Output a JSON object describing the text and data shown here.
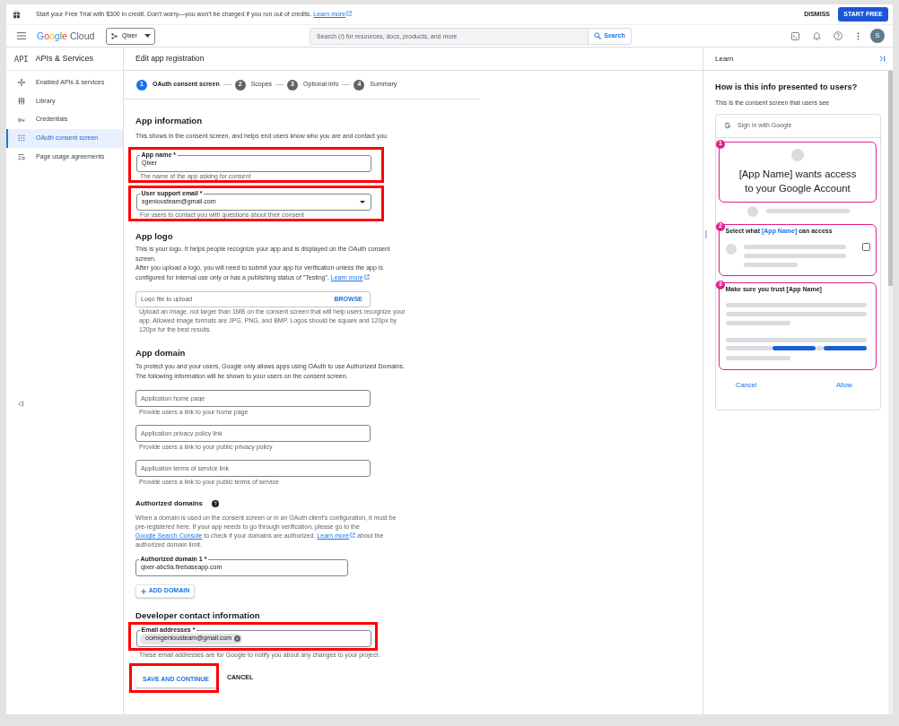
{
  "banner": {
    "message": [
      {
        "kind": "text",
        "text": "Start your Free Trial with $300 in credit. Don't worry—you won't be charged if you run out of credits."
      },
      {
        "kind": "link",
        "text": "Learn more",
        "external": true
      }
    ],
    "dismiss": "DISMISS",
    "action": "START FREE"
  },
  "header": {
    "logo": {
      "brand": "Google",
      "product": "Cloud"
    },
    "project": "Qixer",
    "search": {
      "placeholder": "Search (/) for resources, docs, products, and more",
      "button": "Search"
    },
    "avatar": "S"
  },
  "sidebar": {
    "badge": "API",
    "title": "APIs & Services",
    "items": [
      {
        "label": "Enabled APIs & services",
        "selected": false
      },
      {
        "label": "Library",
        "selected": false
      },
      {
        "label": "Credentials",
        "selected": false
      },
      {
        "label": "OAuth consent screen",
        "selected": true
      },
      {
        "label": "Page usage agreements",
        "selected": false
      }
    ]
  },
  "page": {
    "title": "Edit app registration",
    "steps": [
      {
        "number": "1",
        "label": "OAuth consent screen",
        "selected": true
      },
      {
        "number": "2",
        "label": "Scopes",
        "selected": false
      },
      {
        "number": "3",
        "label": "Optional info",
        "selected": false
      },
      {
        "number": "4",
        "label": "Summary",
        "selected": false
      }
    ]
  },
  "app_information": {
    "heading": "App information",
    "description": "This shows in the consent screen, and helps end users know who you are and contact you",
    "fields": [
      {
        "kind": "text",
        "label": "App name *",
        "value": "Qixer",
        "helper": "The name of the app asking for consent",
        "highlighted": true
      },
      {
        "kind": "select",
        "label": "User support email *",
        "value": "sgeniousteam@gmail.com",
        "helper": "For users to contact you with questions about their consent",
        "highlighted": true
      }
    ]
  },
  "app_logo": {
    "heading": "App logo",
    "paragraphs": [
      [
        {
          "kind": "text",
          "text": "This is your logo. It helps people recognize your app and is displayed on the OAuth consent screen."
        }
      ],
      [
        {
          "kind": "text",
          "text": "After you upload a logo, you will need to submit your app for verification unless the app is configured for internal use only or has a publishing status of \"Testing\"."
        },
        {
          "kind": "link",
          "text": "Learn more",
          "external": true
        }
      ]
    ],
    "upload": {
      "placeholder": "Logo file to upload",
      "button": "BROWSE",
      "helper": "Upload an image, not larger than 1MB on the consent screen that will help users recognize your app. Allowed image formats are JPG, PNG, and BMP. Logos should be square and 120px by 120px for the best results."
    }
  },
  "app_domain": {
    "heading": "App domain",
    "description": "To protect you and your users, Google only allows apps using OAuth to use Authorized Domains. The following information will be shown to your users on the consent screen.",
    "fields": [
      {
        "placeholder": "Application home page",
        "helper": "Provide users a link to your home page"
      },
      {
        "placeholder": "Application privacy policy link",
        "helper": "Provide users a link to your public privacy policy"
      },
      {
        "placeholder": "Application terms of service link",
        "helper": "Provide users a link to your public terms of service"
      }
    ]
  },
  "authorized_domains": {
    "heading": "Authorized domains",
    "paragraph": [
      {
        "kind": "text",
        "text": "When a domain is used on the consent screen or in an OAuth client's configuration, it must be pre-registered here. If your app needs to go through verification, please go to the"
      },
      {
        "kind": "link",
        "text": "Google Search Console",
        "external": false
      },
      {
        "kind": "text",
        "text": "to check if your domains are authorized."
      },
      {
        "kind": "link",
        "text": "Learn more",
        "external": true
      },
      {
        "kind": "text",
        "text": "about the authorized domain limit."
      }
    ],
    "fields": [
      {
        "label": "Authorized domain 1 *",
        "value": "qixer-abc9a.firebaseapp.com"
      }
    ],
    "add_button": "ADD DOMAIN"
  },
  "developer_contact": {
    "heading": "Developer contact information",
    "field": {
      "label": "Email addresses *",
      "chips": [
        "oomxgeniousteam@gmail.com"
      ],
      "helper": "These email addresses are for Google to notify you about any changes to your project.",
      "highlighted": true
    }
  },
  "actions": {
    "save": {
      "label": "SAVE AND CONTINUE",
      "highlighted": true
    },
    "cancel": "CANCEL"
  },
  "learn_panel": {
    "title": "Learn",
    "heading": "How is this info presented to users?",
    "subheading": "This is the consent screen that users see",
    "preview": {
      "header": "Sign in with Google",
      "sections": [
        {
          "number": "1",
          "kind": "identity",
          "title": [
            {
              "kind": "plain",
              "text": "[App Name] wants access to your Google Account"
            }
          ]
        },
        {
          "number": "2",
          "kind": "access",
          "title": [
            {
              "kind": "plain",
              "text": "Select what"
            },
            {
              "kind": "accent",
              "text": "[App Name]"
            },
            {
              "kind": "plain",
              "text": "can access"
            }
          ],
          "checked": false
        },
        {
          "number": "3",
          "kind": "trust",
          "title": [
            {
              "kind": "plain",
              "text": "Make sure you trust [App Name]"
            }
          ]
        }
      ],
      "buttons": [
        "Cancel",
        "Allow"
      ]
    }
  }
}
